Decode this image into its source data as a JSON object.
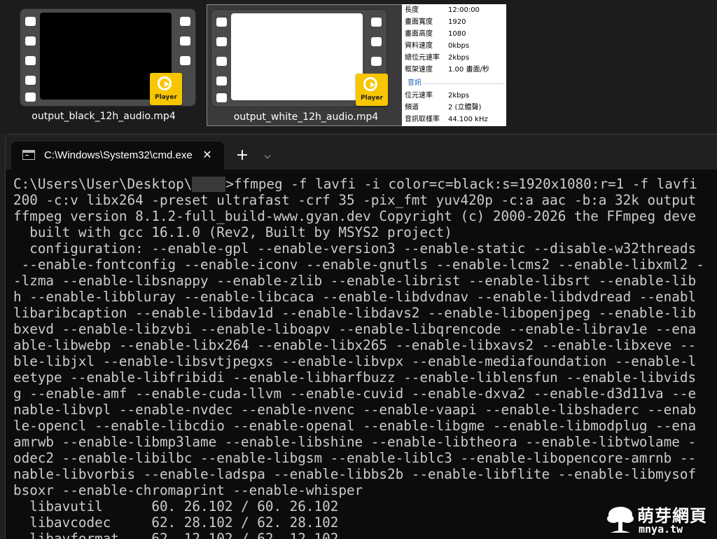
{
  "explorer": {
    "files": [
      {
        "name": "output_black_12h_audio.mp4",
        "badge_label": "Player",
        "selected": false
      },
      {
        "name": "output_white_12h_audio.mp4",
        "badge_label": "Player",
        "selected": true
      }
    ],
    "properties": {
      "rows": [
        {
          "label": "長度",
          "value": "12:00:00"
        },
        {
          "label": "畫面寬度",
          "value": "1920"
        },
        {
          "label": "畫面高度",
          "value": "1080"
        },
        {
          "label": "資料速度",
          "value": "0kbps"
        },
        {
          "label": "總位元速率",
          "value": "2kbps"
        },
        {
          "label": "框架速度",
          "value": "1.00 畫面/秒"
        }
      ],
      "audio_section": "音訊",
      "audio_rows": [
        {
          "label": "位元速率",
          "value": "2kbps"
        },
        {
          "label": "頻道",
          "value": "2 (立體聲)"
        },
        {
          "label": "音訊取樣率",
          "value": "44.100 kHz"
        }
      ]
    }
  },
  "terminal": {
    "tab_title": "C:\\Windows\\System32\\cmd.exe",
    "close_glyph": "✕",
    "new_tab_glyph": "+",
    "dropdown_glyph": "⌵",
    "prompt_prefix": "C:\\Users\\User\\Desktop\\",
    "prompt_command": ">ffmpeg -f lavfi -i color=c=black:s=1920x1080:r=1 -f lavfi",
    "lines": [
      "200 -c:v libx264 -preset ultrafast -crf 35 -pix_fmt yuv420p -c:a aac -b:a 32k output",
      "ffmpeg version 8.1.2-full_build-www.gyan.dev Copyright (c) 2000-2026 the FFmpeg deve",
      "  built with gcc 16.1.0 (Rev2, Built by MSYS2 project)",
      "  configuration: --enable-gpl --enable-version3 --enable-static --disable-w32threads",
      " --enable-fontconfig --enable-iconv --enable-gnutls --enable-lcms2 --enable-libxml2 -",
      "-lzma --enable-libsnappy --enable-zlib --enable-librist --enable-libsrt --enable-lib",
      "h --enable-libbluray --enable-libcaca --enable-libdvdnav --enable-libdvdread --enabl",
      "libaribcaption --enable-libdav1d --enable-libdavs2 --enable-libopenjpeg --enable-lib",
      "bxevd --enable-libzvbi --enable-liboapv --enable-libqrencode --enable-librav1e --ena",
      "able-libwebp --enable-libx264 --enable-libx265 --enable-libxavs2 --enable-libxeve --",
      "ble-libjxl --enable-libsvtjpegxs --enable-libvpx --enable-mediafoundation --enable-l",
      "eetype --enable-libfribidi --enable-libharfbuzz --enable-liblensfun --enable-libvids",
      "g --enable-amf --enable-cuda-llvm --enable-cuvid --enable-dxva2 --enable-d3d11va --e",
      "nable-libvpl --enable-nvdec --enable-nvenc --enable-vaapi --enable-libshaderc --enab",
      "le-opencl --enable-libcdio --enable-openal --enable-libgme --enable-libmodplug --ena",
      "amrwb --enable-libmp3lame --enable-libshine --enable-libtheora --enable-libtwolame -",
      "odec2 --enable-libilbc --enable-libgsm --enable-liblc3 --enable-libopencore-amrnb --",
      "nable-libvorbis --enable-ladspa --enable-libbs2b --enable-libflite --enable-libmysof",
      "bsoxr --enable-chromaprint --enable-whisper",
      "  libavutil      60. 26.102 / 60. 26.102",
      "  libavcodec     62. 28.102 / 62. 28.102",
      "  libavformat    62. 12.102 / 62. 12.102"
    ]
  },
  "watermark": {
    "brand": "萌芽網頁",
    "domain": "mnya.tw"
  }
}
